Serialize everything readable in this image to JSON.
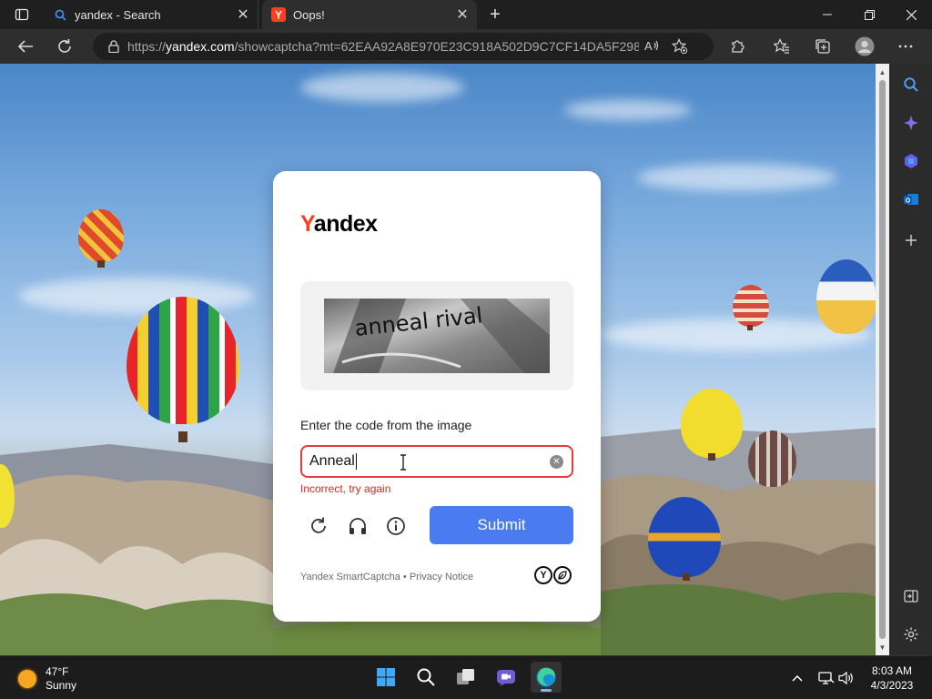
{
  "browser": {
    "tabs": [
      {
        "title": "yandex - Search",
        "favicon": "search-icon",
        "active": false
      },
      {
        "title": "Oops!",
        "favicon": "yandex-favicon",
        "active": true
      }
    ],
    "address_bar": {
      "url_prefix": "https://",
      "url_domain": "yandex.com",
      "url_rest": "/showcaptcha?mt=62EAA92A8E970E23C918A502D9C7CF14DA5F298..."
    }
  },
  "captcha": {
    "logo": {
      "first_letter": "Y",
      "rest": "andex"
    },
    "image_text": "anneal rival",
    "prompt": "Enter the code from the image",
    "input_value": "Anneal",
    "error": "Incorrect, try again",
    "submit_label": "Submit",
    "footer": {
      "brand": "Yandex SmartCaptcha",
      "separator": " • ",
      "privacy": "Privacy Notice"
    }
  },
  "taskbar": {
    "weather": {
      "temp": "47°F",
      "condition": "Sunny"
    },
    "time": "8:03 AM",
    "date": "4/3/2023"
  },
  "colors": {
    "submit_button": "#4b7bf0",
    "error_red": "#d52b1e",
    "yandex_red": "#fc3f1d",
    "browser_chrome": "#2e2e2e"
  }
}
